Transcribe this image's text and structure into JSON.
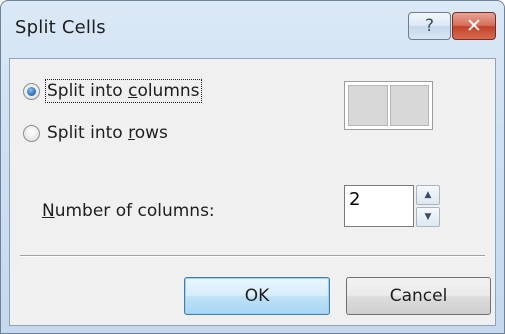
{
  "window": {
    "title": "Split Cells",
    "help_glyph": "?",
    "close_glyph": "✕"
  },
  "split": {
    "columns_option": {
      "label_pre": "Split into ",
      "label_mn": "c",
      "label_post": "olumns",
      "selected": true
    },
    "rows_option": {
      "label_pre": "Split into ",
      "label_mn": "r",
      "label_post": "ows",
      "selected": false
    }
  },
  "preview": {
    "icon": "two-columns-preview"
  },
  "columns_count": {
    "label_mn": "N",
    "label_post": "umber of columns:",
    "value": "2",
    "up_glyph": "▲",
    "down_glyph": "▼"
  },
  "buttons": {
    "ok": "OK",
    "cancel": "Cancel"
  }
}
